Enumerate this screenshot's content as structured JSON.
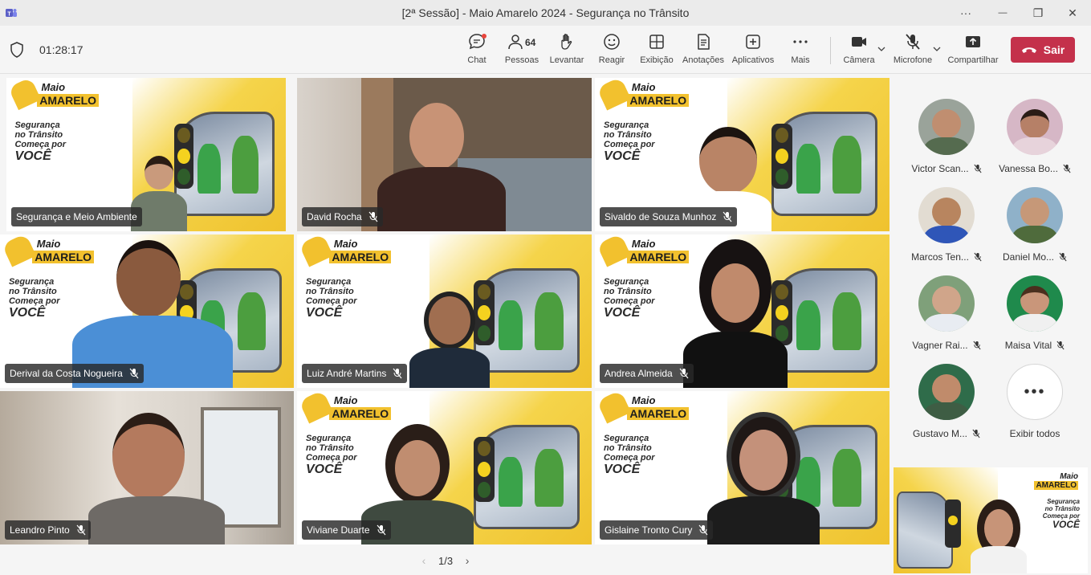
{
  "window": {
    "title": "[2ª Sessão] - Maio Amarelo 2024 - Segurança no Trânsito",
    "more_glyph": "···",
    "minimize_glyph": "—",
    "restore_glyph": "❐",
    "close_glyph": "✕"
  },
  "toolbar": {
    "timer": "01:28:17",
    "items": {
      "chat": "Chat",
      "people": "Pessoas",
      "people_count": "64",
      "raise": "Levantar",
      "react": "Reagir",
      "view": "Exibição",
      "notes": "Anotações",
      "apps": "Aplicativos",
      "more": "Mais",
      "camera": "Câmera",
      "mic": "Microfone",
      "share": "Compartilhar"
    },
    "leave_label": "Sair",
    "accent": "#c4314b"
  },
  "brand": {
    "logo_line1": "Maio",
    "logo_line2": "AMARELO",
    "slogan_line1": "Segurança",
    "slogan_line2": "no Trânsito",
    "slogan_line3": "Começa por",
    "slogan_line4": "VOCÊ",
    "logo_color": "#f2c12e"
  },
  "tiles": [
    {
      "name": "Segurança e Meio Ambiente",
      "muted": false
    },
    {
      "name": "David Rocha",
      "muted": true
    },
    {
      "name": "Sivaldo de Souza Munhoz",
      "muted": true
    },
    {
      "name": "Derival da Costa Nogueira",
      "muted": true
    },
    {
      "name": "Luiz André Martins",
      "muted": true
    },
    {
      "name": "Andrea Almeida",
      "muted": true
    },
    {
      "name": "Leandro Pinto",
      "muted": true
    },
    {
      "name": "Viviane Duarte",
      "muted": true
    },
    {
      "name": "Gislaine Tronto Cury",
      "muted": true
    }
  ],
  "pager": {
    "label": "1/3",
    "prev": "‹",
    "next": "›"
  },
  "rail": {
    "participants": [
      {
        "name": "Victor Scan..."
      },
      {
        "name": "Vanessa Bo..."
      },
      {
        "name": "Marcos Ten..."
      },
      {
        "name": "Daniel Mo..."
      },
      {
        "name": "Vagner Rai..."
      },
      {
        "name": "Maisa Vital"
      },
      {
        "name": "Gustavo M..."
      }
    ],
    "show_all_label": "Exibir todos",
    "more_glyph": "•••"
  }
}
